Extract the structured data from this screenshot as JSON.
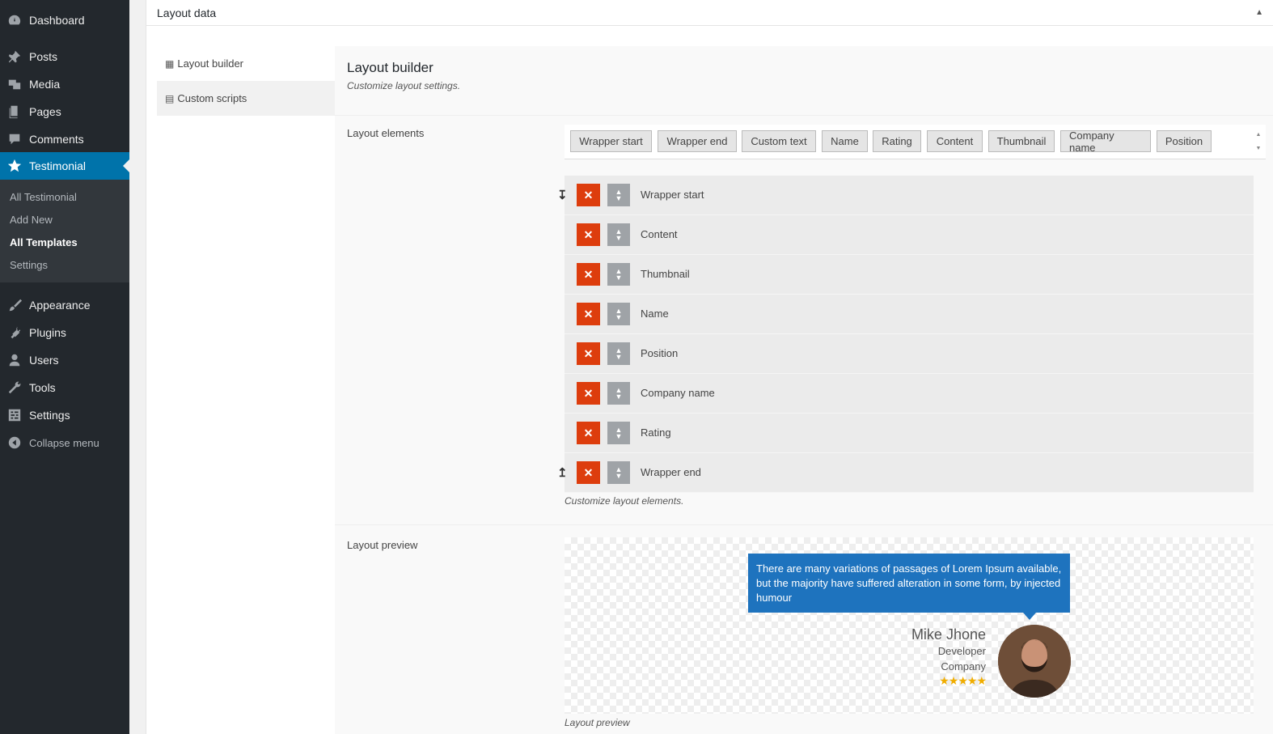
{
  "sidebar": {
    "items": [
      {
        "label": "Dashboard",
        "icon": "dashboard-icon"
      },
      {
        "label": "Posts",
        "icon": "pin-icon"
      },
      {
        "label": "Media",
        "icon": "media-icon"
      },
      {
        "label": "Pages",
        "icon": "pages-icon"
      },
      {
        "label": "Comments",
        "icon": "comments-icon"
      },
      {
        "label": "Testimonial",
        "icon": "star-icon"
      },
      {
        "label": "Appearance",
        "icon": "brush-icon"
      },
      {
        "label": "Plugins",
        "icon": "plug-icon"
      },
      {
        "label": "Users",
        "icon": "user-icon"
      },
      {
        "label": "Tools",
        "icon": "wrench-icon"
      },
      {
        "label": "Settings",
        "icon": "settings-icon"
      },
      {
        "label": "Collapse menu",
        "icon": "collapse-icon"
      }
    ],
    "submenu": [
      "All Testimonial",
      "Add New",
      "All Templates",
      "Settings"
    ],
    "accent": "#0073aa"
  },
  "postbox": {
    "title": "Layout data"
  },
  "tabs": [
    "Layout builder",
    "Custom scripts"
  ],
  "panel": {
    "title": "Layout builder",
    "desc": "Customize layout settings.",
    "elements_label": "Layout elements",
    "elements_desc": "Customize layout elements.",
    "preview_label": "Layout preview",
    "preview_desc": "Layout preview"
  },
  "shortcuts": [
    "Wrapper start",
    "Wrapper end",
    "Custom text",
    "Name",
    "Rating",
    "Content",
    "Thumbnail",
    "Company name",
    "Position"
  ],
  "elements": [
    "Wrapper start",
    "Content",
    "Thumbnail",
    "Name",
    "Position",
    "Company name",
    "Rating",
    "Wrapper end"
  ],
  "preview": {
    "quote": "There are many variations of passages of Lorem Ipsum available, but the majority have suffered alteration in some form, by injected humour",
    "name": "Mike Jhone",
    "position": "Developer",
    "company": "Company",
    "rating": 5,
    "stars": "★★★★★"
  },
  "colors": {
    "delete": "#dd3d0d",
    "quote_bg": "#1e73be",
    "star": "#f0ad00"
  }
}
